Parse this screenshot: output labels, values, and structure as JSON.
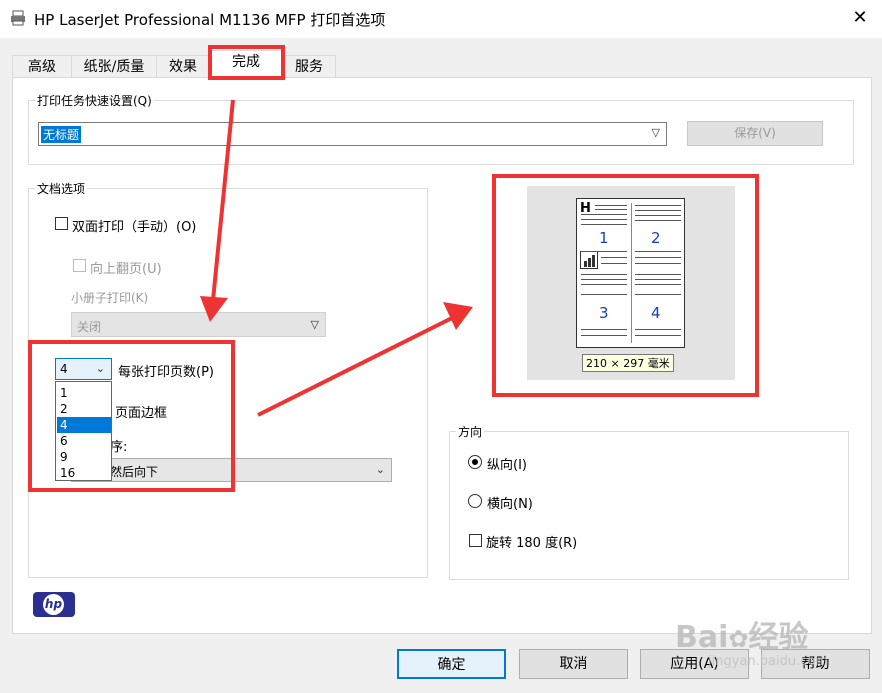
{
  "window": {
    "title": "HP LaserJet Professional M1136 MFP 打印首选项",
    "close_glyph": "✕",
    "printer_icon": "printer-icon"
  },
  "tabs": [
    {
      "label": "高级"
    },
    {
      "label": "纸张/质量"
    },
    {
      "label": "效果"
    },
    {
      "label": "完成"
    },
    {
      "label": "服务"
    }
  ],
  "quick_set": {
    "legend": "打印任务快速设置(Q)",
    "value": "无标题",
    "save_label": "保存(V)"
  },
  "doc_options": {
    "legend": "文档选项",
    "duplex_label": "双面打印（手动）(O)",
    "flip_up_label": "向上翻页(U)",
    "booklet_label": "小册子打印(K)",
    "booklet_value": "关闭",
    "pages_per_sheet_value": "4",
    "pages_per_sheet_label": "每张打印页数(P)",
    "pages_options": [
      "1",
      "2",
      "4",
      "6",
      "9",
      "16"
    ],
    "selected_option": "4",
    "border_label": "页面边框",
    "order_label_partial": "序:",
    "order_value_partial": "然后向下"
  },
  "preview": {
    "page_numbers": [
      "1",
      "2",
      "3",
      "4"
    ],
    "header_glyph": "H",
    "size_label": "210 × 297 毫米"
  },
  "orientation": {
    "legend": "方向",
    "portrait_label": "纵向(I)",
    "landscape_label": "横向(N)",
    "rotate_label": "旋转 180 度(R)",
    "selected": "portrait"
  },
  "logo": {
    "text": "hp"
  },
  "buttons": {
    "ok": "确定",
    "cancel": "取消",
    "apply": "应用(A)",
    "help": "帮助"
  },
  "watermark": {
    "brand": "Bai",
    "brand_suffix": "经验",
    "url": "jingyan.baidu.com"
  },
  "colors": {
    "accent": "#0078d7",
    "annotation_red": "#ee3333",
    "selection_blue": "#0078d7"
  }
}
